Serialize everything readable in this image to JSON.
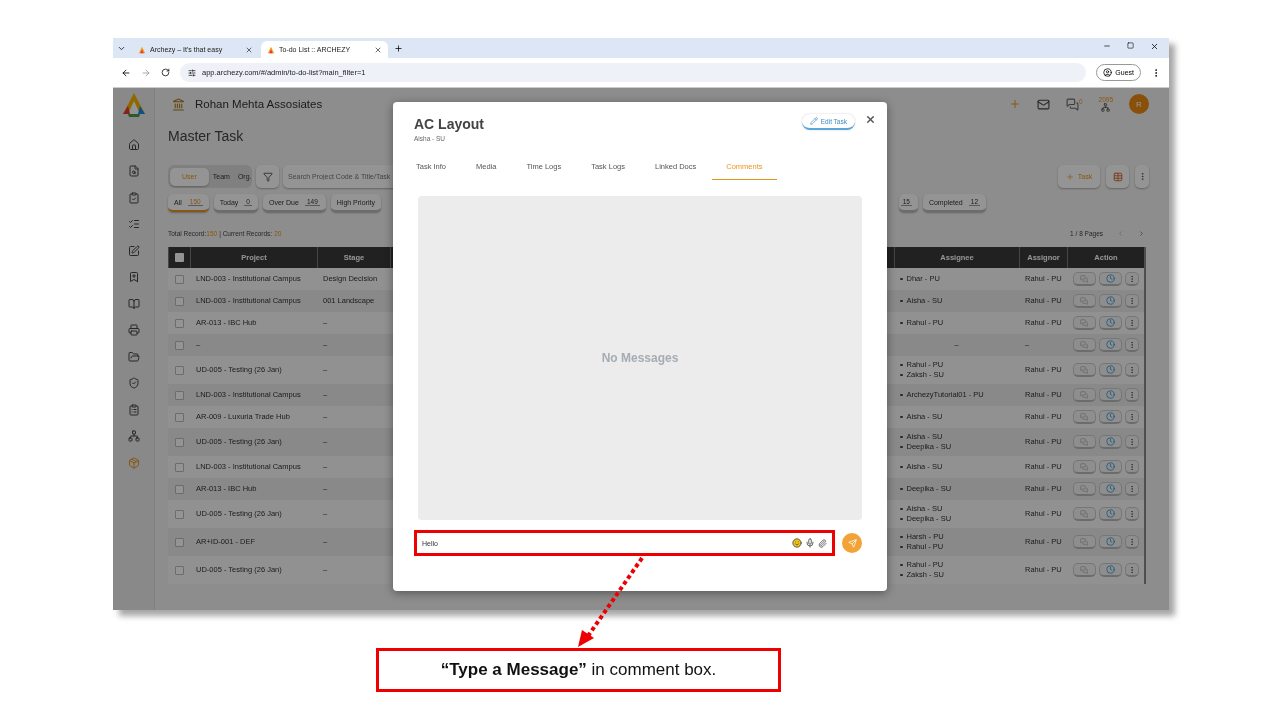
{
  "browser": {
    "tabs": [
      {
        "title": "Archezy – It's that easy",
        "selected": false
      },
      {
        "title": "To-do List :: ARCHEZY",
        "selected": true
      }
    ],
    "url": "app.archezy.com/#/admin/to-do-list?main_filter=1",
    "profile": "Guest"
  },
  "app": {
    "company": "Rohan Mehta Assosiates",
    "page_title": "Master Task",
    "header": {
      "chat_count": "0",
      "points": "2095",
      "avatar": "R"
    },
    "scope_tabs": [
      {
        "label": "User",
        "selected": true
      },
      {
        "label": "Team",
        "selected": false
      },
      {
        "label": "Org.",
        "selected": false
      }
    ],
    "search": {
      "placeholder": "Search Project Code & Title/Task"
    },
    "add_button": "Task",
    "filters_left": [
      {
        "label": "All",
        "count": "150",
        "selected": true
      },
      {
        "label": "Today",
        "count": "0",
        "selected": false
      },
      {
        "label": "Over Due",
        "count": "149",
        "selected": false
      },
      {
        "label": "High Priority",
        "selected": false
      }
    ],
    "filters_right": [
      {
        "count": "15",
        "selected": false
      },
      {
        "label": "Completed",
        "count": "12",
        "selected": false
      }
    ],
    "records": {
      "total_label": "Total Record:",
      "total": "150",
      "current_label": "| Current Records:",
      "current": "20"
    },
    "pager": "1 / 8 Pages",
    "table": {
      "select_all_checked": false,
      "columns_left": [
        "Project",
        "Stage"
      ],
      "columns_right": [
        "Assignee",
        "Assignor",
        "Action"
      ],
      "rows": [
        {
          "checked": false,
          "project": "LND-003 - Institutional Campus",
          "stage": "Design Decision",
          "assignees": [
            "Dhar - PU"
          ],
          "assignor": "Rahul - PU"
        },
        {
          "checked": false,
          "project": "LND-003 - Institutional Campus",
          "stage": "001 Landscape",
          "assignees": [
            "Aisha - SU"
          ],
          "assignor": "Rahul - PU"
        },
        {
          "checked": false,
          "project": "AR-013 - IBC Hub",
          "stage": "–",
          "assignees": [
            "Rahul - PU"
          ],
          "assignor": "Rahul - PU"
        },
        {
          "checked": false,
          "project": "–",
          "stage": "–",
          "assignee": "–",
          "assignor": "–"
        },
        {
          "checked": false,
          "project": "UD-005 - Testing (26 Jan)",
          "stage": "–",
          "assignees": [
            "Rahul - PU",
            "Zaksh - SU"
          ],
          "assignor": "Rahul - PU"
        },
        {
          "checked": false,
          "project": "LND-003 - Institutional Campus",
          "stage": "–",
          "assignees": [
            "ArchezyTutorial01 - PU"
          ],
          "assignor": "Rahul - PU"
        },
        {
          "checked": false,
          "project": "AR-009 - Luxuria Trade Hub",
          "stage": "–",
          "assignees": [
            "Aisha - SU"
          ],
          "assignor": "Rahul - PU"
        },
        {
          "checked": false,
          "project": "UD-005 - Testing (26 Jan)",
          "stage": "–",
          "assignees": [
            "Aisha - SU",
            "Deepika - SU"
          ],
          "assignor": "Rahul - PU"
        },
        {
          "checked": false,
          "project": "LND-003 - Institutional Campus",
          "stage": "–",
          "assignees": [
            "Aisha - SU"
          ],
          "assignor": "Rahul - PU"
        },
        {
          "checked": false,
          "project": "AR-013 - IBC Hub",
          "stage": "–",
          "assignees": [
            "Deepika - SU"
          ],
          "assignor": "Rahul - PU"
        },
        {
          "checked": false,
          "project": "UD-005 - Testing (26 Jan)",
          "stage": "–",
          "assignees": [
            "Aisha - SU",
            "Deepika - SU"
          ],
          "assignor": "Rahul - PU"
        },
        {
          "checked": false,
          "project": "AR+ID-001 - DEF",
          "stage": "–",
          "assignees": [
            "Harsh - PU",
            "Rahul - PU"
          ],
          "assignor": "Rahul - PU"
        },
        {
          "checked": false,
          "project": "UD-005 - Testing (26 Jan)",
          "stage": "–",
          "assignees": [
            "Rahul - PU",
            "Zaksh - SU"
          ],
          "assignor": "Rahul - PU"
        }
      ]
    }
  },
  "modal": {
    "title": "AC Layout",
    "subtitle": "Aisha - SU",
    "edit_button": "Edit Task",
    "tabs": [
      {
        "label": "Task Info",
        "selected": false
      },
      {
        "label": "Media",
        "selected": false
      },
      {
        "label": "Time Logs",
        "selected": false
      },
      {
        "label": "Task Logs",
        "selected": false
      },
      {
        "label": "Linked Docs",
        "selected": false
      },
      {
        "label": "Comments",
        "selected": true
      }
    ],
    "empty_text": "No Messages",
    "message": {
      "value": "Hello"
    }
  },
  "callout": "**“Type a Message”** in comment box."
}
